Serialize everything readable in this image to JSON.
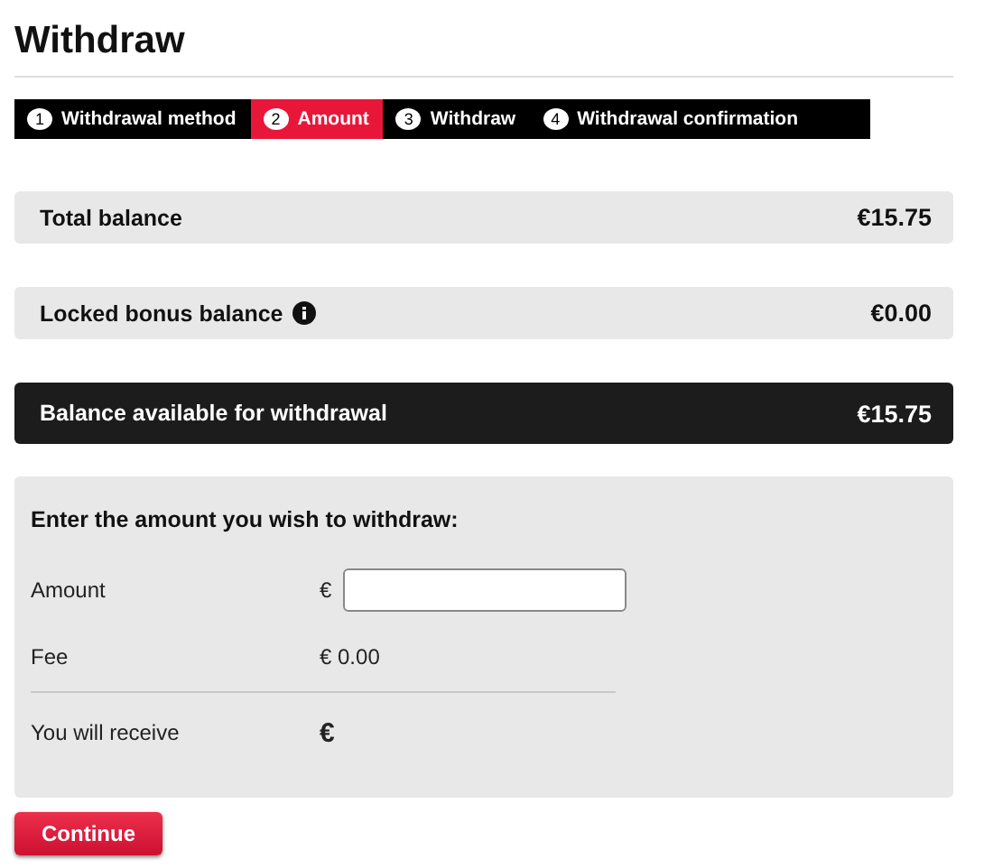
{
  "title": "Withdraw",
  "steps": [
    {
      "number": "1",
      "label": "Withdrawal method",
      "selected": false
    },
    {
      "number": "2",
      "label": "Amount",
      "selected": true
    },
    {
      "number": "3",
      "label": "Withdraw",
      "selected": false
    },
    {
      "number": "4",
      "label": "Withdrawal confirmation",
      "selected": false
    }
  ],
  "balances": [
    {
      "kind": "plain",
      "label": "Total balance",
      "info": false,
      "value": "€15.75"
    },
    {
      "kind": "plain",
      "label": "Locked bonus balance",
      "info": true,
      "value": "€0.00"
    },
    {
      "kind": "highlight",
      "label": "Balance available for withdrawal",
      "info": false,
      "value": "€15.75"
    }
  ],
  "form": {
    "heading": "Enter the amount you wish to withdraw:",
    "rows": [
      {
        "kind": "input",
        "label": "Amount",
        "currency": "€"
      },
      {
        "kind": "text",
        "label": "Fee",
        "value": "€ 0.00"
      },
      {
        "kind": "total",
        "label": "You will receive",
        "value": "€"
      }
    ]
  },
  "continue_button": "Continue"
}
